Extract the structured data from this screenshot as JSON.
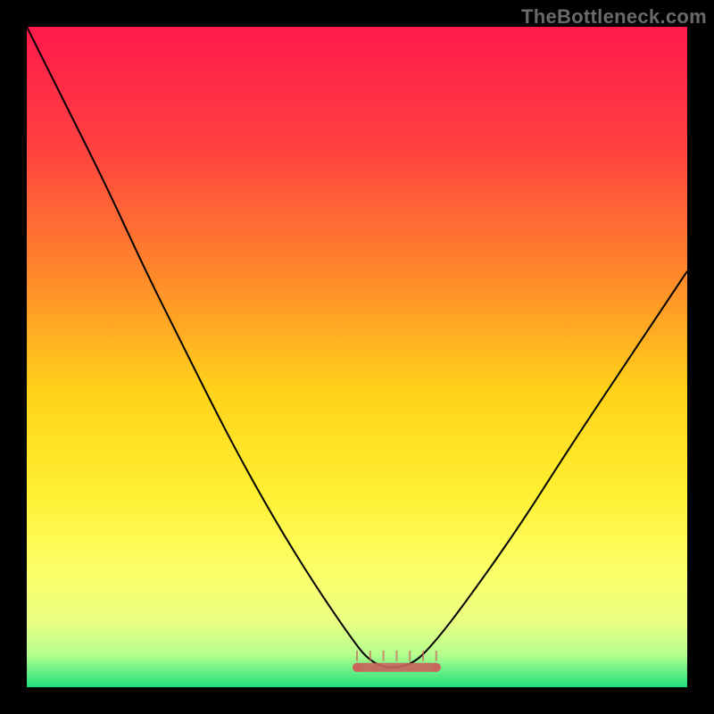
{
  "watermark": "TheBottleneck.com",
  "chart_data": {
    "type": "line",
    "title": "",
    "xlabel": "",
    "ylabel": "",
    "xlim": [
      0,
      100
    ],
    "ylim": [
      0,
      100
    ],
    "grid": false,
    "legend": false,
    "background_gradient_stops": [
      {
        "offset": 0,
        "color": "#ff1a4b"
      },
      {
        "offset": 18,
        "color": "#ff4040"
      },
      {
        "offset": 38,
        "color": "#ff8a2a"
      },
      {
        "offset": 55,
        "color": "#ffd21a"
      },
      {
        "offset": 70,
        "color": "#ffef30"
      },
      {
        "offset": 82,
        "color": "#fcff66"
      },
      {
        "offset": 90,
        "color": "#eaff82"
      },
      {
        "offset": 95,
        "color": "#b6ff8f"
      },
      {
        "offset": 100,
        "color": "#1fe07a"
      }
    ],
    "series": [
      {
        "name": "bottleneck-curve",
        "color": "#000000",
        "stroke_width": 2,
        "x": [
          0,
          6,
          12,
          18,
          24,
          30,
          36,
          42,
          48,
          52.5,
          58,
          62,
          68,
          75,
          82,
          90,
          98,
          100
        ],
        "values": [
          100,
          88,
          76,
          63,
          51,
          39,
          28,
          18,
          9,
          3,
          3,
          7,
          15,
          25,
          36,
          48,
          60,
          63
        ]
      }
    ],
    "flat_segment": {
      "name": "optimal-zone",
      "color": "#c9635c",
      "stroke_width": 10,
      "opacity": 0.9,
      "x_start": 50,
      "x_end": 62,
      "y": 3,
      "endpoint_radius": 5
    },
    "flat_segment_markers": {
      "count": 7,
      "height": 1.6,
      "color": "#c9635c"
    }
  }
}
